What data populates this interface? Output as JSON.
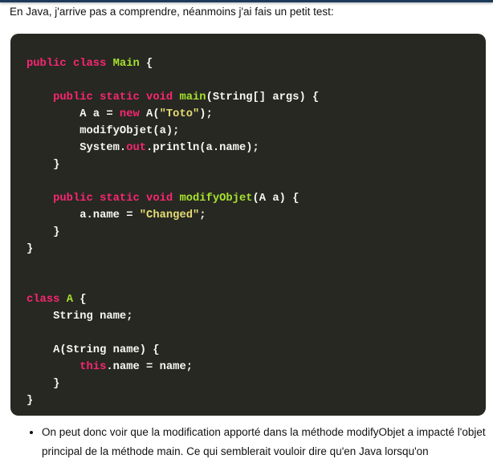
{
  "intro": "En Java, j'arrive pas a comprendre, néanmoins j'ai fais un petit test:",
  "code_lines": [
    [
      [
        "kw",
        "public class "
      ],
      [
        "cls",
        "Main"
      ],
      [
        "pl",
        " {"
      ]
    ],
    [],
    [
      [
        "pl",
        "    "
      ],
      [
        "kw",
        "public static void "
      ],
      [
        "cls",
        "main"
      ],
      [
        "pl",
        "(String[] args) {"
      ]
    ],
    [
      [
        "pl",
        "        A a = "
      ],
      [
        "kw",
        "new "
      ],
      [
        "pl",
        "A("
      ],
      [
        "str",
        "\"Toto\""
      ],
      [
        "pl",
        ");"
      ]
    ],
    [
      [
        "pl",
        "        modifyObjet(a);"
      ]
    ],
    [
      [
        "pl",
        "        System."
      ],
      [
        "kw",
        "out"
      ],
      [
        "pl",
        ".println(a.name);"
      ]
    ],
    [
      [
        "pl",
        "    }"
      ]
    ],
    [],
    [
      [
        "pl",
        "    "
      ],
      [
        "kw",
        "public static void "
      ],
      [
        "cls",
        "modifyObjet"
      ],
      [
        "pl",
        "(A a) {"
      ]
    ],
    [
      [
        "pl",
        "        a.name = "
      ],
      [
        "str",
        "\"Changed\""
      ],
      [
        "pl",
        ";"
      ]
    ],
    [
      [
        "pl",
        "    }"
      ]
    ],
    [
      [
        "pl",
        "}"
      ]
    ],
    [],
    [],
    [
      [
        "kw",
        "class "
      ],
      [
        "cls",
        "A"
      ],
      [
        "pl",
        " {"
      ]
    ],
    [
      [
        "pl",
        "    String name;"
      ]
    ],
    [],
    [
      [
        "pl",
        "    A(String name) {"
      ]
    ],
    [
      [
        "pl",
        "        "
      ],
      [
        "kw",
        "this"
      ],
      [
        "pl",
        ".name = name;"
      ]
    ],
    [
      [
        "pl",
        "    }"
      ]
    ],
    [
      [
        "pl",
        "}"
      ]
    ]
  ],
  "bullet": "On peut donc voir que la modification apporté dans la méthode modifyObjet a impacté l'objet principal de la méthode main. Ce qui semblerait vouloir dire qu'en Java lorsqu'on",
  "colors": {
    "keyword": "#f92672",
    "class": "#a6e22e",
    "string": "#e6db74",
    "background": "#272822"
  }
}
